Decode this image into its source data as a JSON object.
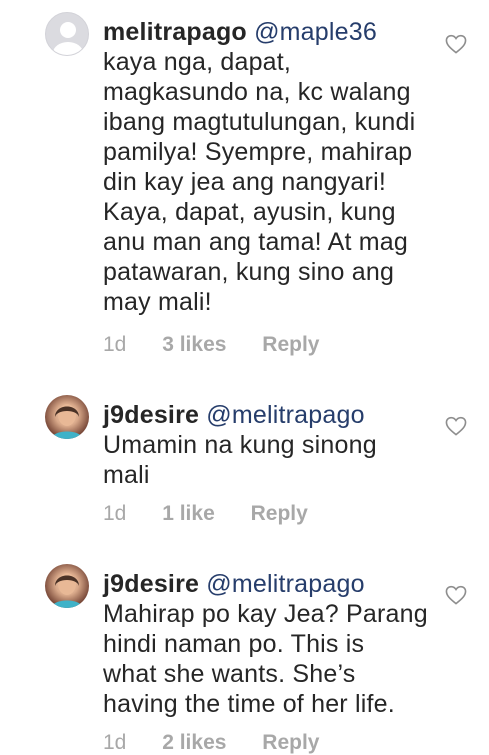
{
  "comments": [
    {
      "username": "melitrapago",
      "mention": "@maple36",
      "text": "kaya nga, dapat,\nmagkasundo na, kc walang\nibang magtutulungan, kundi\npamilya!  Syempre, mahirap\ndin kay jea ang nangyari!\nKaya, dapat, ayusin, kung\nanu man ang tama! At mag\npatawaran, kung sino ang\nmay mali!",
      "time": "1d",
      "likes": "3 likes",
      "reply": "Reply",
      "avatar": "default-avatar"
    },
    {
      "username": "j9desire",
      "mention": "@melitrapago",
      "text": "Umamin na kung sinong\nmali",
      "time": "1d",
      "likes": "1 like",
      "reply": "Reply",
      "avatar": "photo-avatar"
    },
    {
      "username": "j9desire",
      "mention": "@melitrapago",
      "text": "Mahirap po kay Jea? Parang\nhindi naman po. This is\nwhat she wants. She’s\nhaving the time of her life.",
      "time": "1d",
      "likes": "2 likes",
      "reply": "Reply",
      "avatar": "photo-avatar"
    }
  ],
  "colors": {
    "text": "#262626",
    "mention": "#263d6b",
    "meta": "#a8a8a8"
  }
}
